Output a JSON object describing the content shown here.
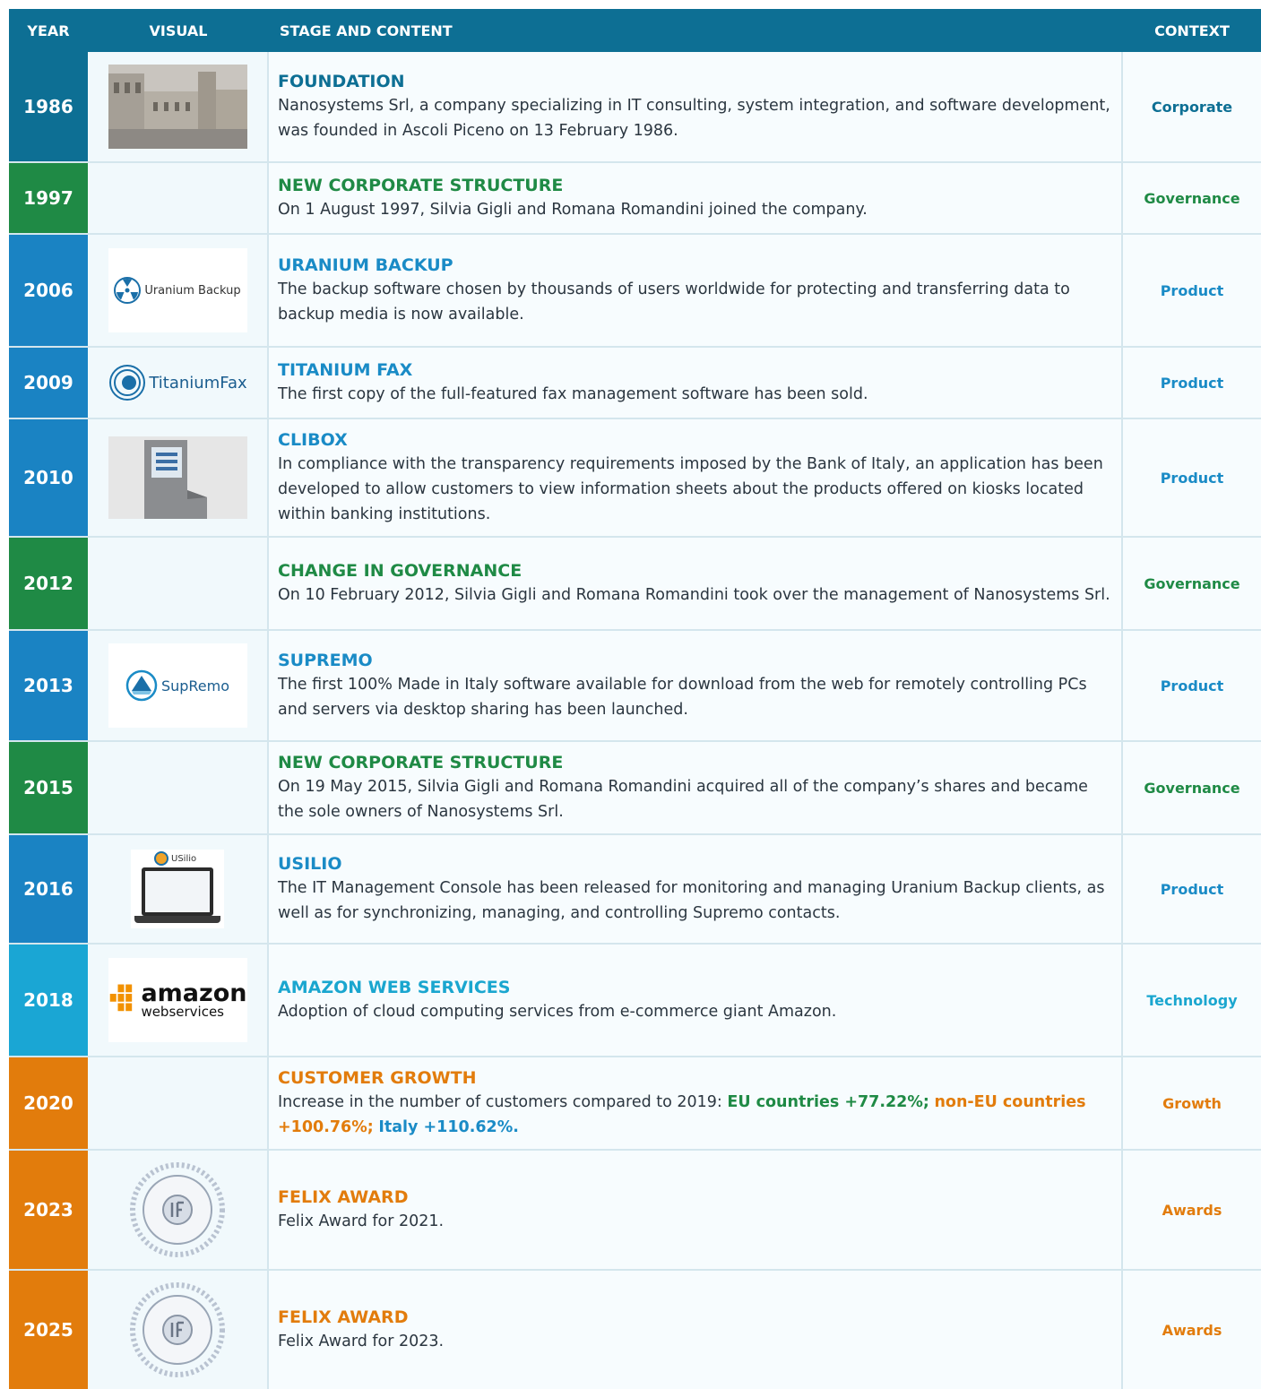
{
  "header": {
    "year": "YEAR",
    "visual": "VISUAL",
    "stage": "STAGE AND CONTENT",
    "context": "CONTEXT"
  },
  "rows": [
    {
      "year": "1986",
      "title": "FOUNDATION",
      "desc": "Nanosystems Srl, a company specializing in IT consulting, system integration, and software development, was founded in Ascoli Piceno on 13 February 1986.",
      "context": "Corporate",
      "color": "#0d6f94",
      "visual": "city-square-photo"
    },
    {
      "year": "1997",
      "title": "NEW CORPORATE STRUCTURE",
      "desc": "On 1 August 1997, Silvia Gigli and Romana Romandini joined the company.",
      "context": "Governance",
      "color": "#1f8a45",
      "visual": ""
    },
    {
      "year": "2006",
      "title": "URANIUM BACKUP",
      "desc": "The backup software chosen by thousands of users worldwide for protecting and transferring data to backup media is now available.",
      "context": "Product",
      "color": "#1a8bc6",
      "visual": "uranium-backup-logo",
      "logo_text": "Uranium Backup"
    },
    {
      "year": "2009",
      "title": "TITANIUM FAX",
      "desc": "The first copy of the full-featured fax management software has been sold.",
      "context": "Product",
      "color": "#1a8bc6",
      "visual": "titanium-fax-logo",
      "logo_text": "TitaniumFax"
    },
    {
      "year": "2010",
      "title": "CLIBOX",
      "desc": "In compliance with the transparency requirements imposed by the Bank of Italy, an application has been developed to allow customers to view information sheets about the products offered on kiosks located within banking institutions.",
      "context": "Product",
      "color": "#1a8bc6",
      "visual": "kiosk-photo"
    },
    {
      "year": "2012",
      "title": "CHANGE IN GOVERNANCE",
      "desc": "On 10 February 2012, Silvia Gigli and Romana Romandini took over the management of Nanosystems Srl.",
      "context": "Governance",
      "color": "#1f8a45",
      "visual": ""
    },
    {
      "year": "2013",
      "title": "SUPREMO",
      "desc": "The first 100% Made in Italy software available for download from the web for remotely controlling PCs and servers via desktop sharing has been launched.",
      "context": "Product",
      "color": "#1a8bc6",
      "visual": "supremo-logo",
      "logo_text": "SupRemo"
    },
    {
      "year": "2015",
      "title": "NEW CORPORATE STRUCTURE",
      "desc": "On 19 May 2015, Silvia Gigli and Romana Romandini acquired all of the company’s shares and became the sole owners of Nanosystems Srl.",
      "context": "Governance",
      "color": "#1f8a45",
      "visual": ""
    },
    {
      "year": "2016",
      "title": "USILIO",
      "desc": "The IT Management Console has been released for monitoring and managing Uranium Backup clients, as well as for synchronizing, managing, and controlling Supremo contacts.",
      "context": "Product",
      "color": "#1a8bc6",
      "visual": "usilio-laptop",
      "logo_text": "USilio"
    },
    {
      "year": "2018",
      "title": "AMAZON WEB SERVICES",
      "desc": "Adoption of cloud computing services from e-commerce giant Amazon.",
      "context": "Technology",
      "color": "#1aa6cf",
      "visual": "aws-logo",
      "logo_text": "amazon",
      "logo_sub": "webservices"
    },
    {
      "year": "2020",
      "title": "CUSTOMER GROWTH",
      "desc": "Increase in the number of customers compared to 2019: ",
      "hl1": "EU countries +77.22%;",
      "hl2": "non-EU countries +100.76%;",
      "hl3": "Italy +110.62%.",
      "context": "Growth",
      "color": "#e27c0c",
      "visual": ""
    },
    {
      "year": "2023",
      "title": "FELIX AWARD",
      "desc": "Felix Award for 2021.",
      "context": "Awards",
      "color": "#e27c0c",
      "visual": "industria-felix-seal"
    },
    {
      "year": "2025",
      "title": "FELIX AWARD",
      "desc": "Felix Award for 2023.",
      "context": "Awards",
      "color": "#e27c0c",
      "visual": "industria-felix-seal"
    }
  ]
}
